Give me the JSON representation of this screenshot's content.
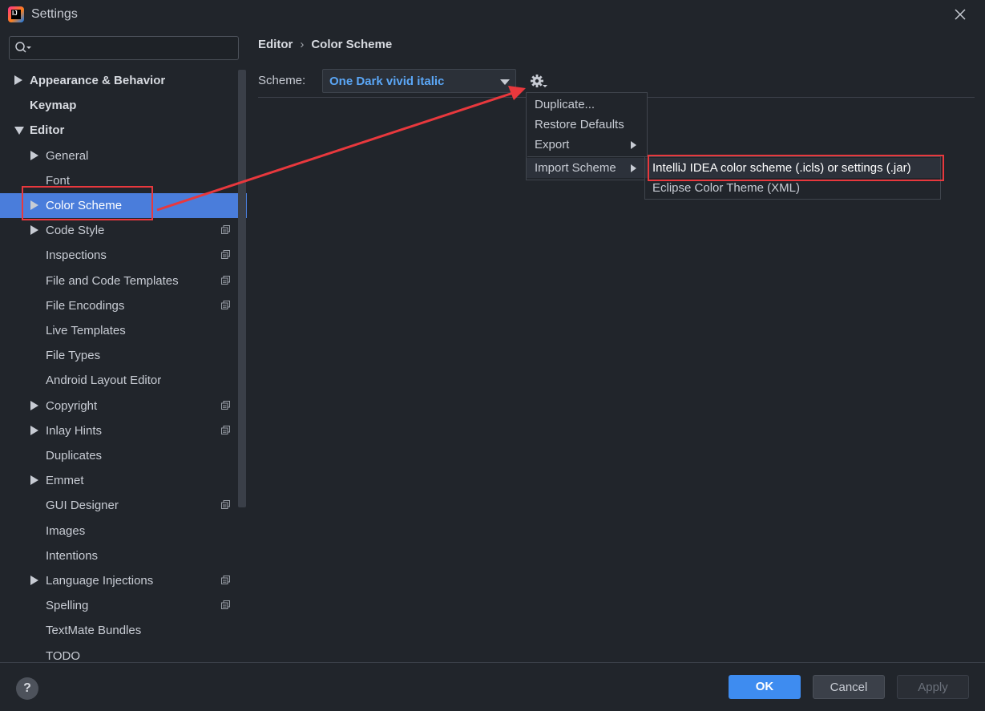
{
  "window": {
    "title": "Settings",
    "app_icon_text": "IJ"
  },
  "search": {
    "placeholder": ""
  },
  "sidebar": {
    "items": [
      {
        "label": "Appearance & Behavior",
        "expander": "right",
        "bold": true
      },
      {
        "label": "Keymap",
        "expander": "none",
        "bold": true
      },
      {
        "label": "Editor",
        "expander": "down",
        "bold": true
      },
      {
        "label": "General",
        "expander": "right"
      },
      {
        "label": "Font",
        "expander": "none"
      },
      {
        "label": "Color Scheme",
        "expander": "right",
        "selected": true
      },
      {
        "label": "Code Style",
        "expander": "right",
        "copy_icon": true
      },
      {
        "label": "Inspections",
        "expander": "none",
        "copy_icon": true
      },
      {
        "label": "File and Code Templates",
        "expander": "none",
        "copy_icon": true
      },
      {
        "label": "File Encodings",
        "expander": "none",
        "copy_icon": true
      },
      {
        "label": "Live Templates",
        "expander": "none"
      },
      {
        "label": "File Types",
        "expander": "none"
      },
      {
        "label": "Android Layout Editor",
        "expander": "none"
      },
      {
        "label": "Copyright",
        "expander": "right",
        "copy_icon": true
      },
      {
        "label": "Inlay Hints",
        "expander": "right",
        "copy_icon": true
      },
      {
        "label": "Duplicates",
        "expander": "none"
      },
      {
        "label": "Emmet",
        "expander": "right"
      },
      {
        "label": "GUI Designer",
        "expander": "none",
        "copy_icon": true
      },
      {
        "label": "Images",
        "expander": "none"
      },
      {
        "label": "Intentions",
        "expander": "none"
      },
      {
        "label": "Language Injections",
        "expander": "right",
        "copy_icon": true
      },
      {
        "label": "Spelling",
        "expander": "none",
        "copy_icon": true
      },
      {
        "label": "TextMate Bundles",
        "expander": "none"
      },
      {
        "label": "TODO",
        "expander": "none"
      }
    ]
  },
  "breadcrumb": {
    "parent": "Editor",
    "separator": "›",
    "current": "Color Scheme"
  },
  "scheme": {
    "label": "Scheme:",
    "value": "One Dark vivid italic"
  },
  "gear_menu": {
    "items": [
      {
        "label": "Duplicate..."
      },
      {
        "label": "Restore Defaults"
      },
      {
        "label": "Export",
        "submenu": true
      },
      {
        "label": "Import Scheme",
        "submenu": true,
        "active": true
      }
    ]
  },
  "import_submenu": {
    "items": [
      {
        "label": "IntelliJ IDEA color scheme (.icls) or settings (.jar)",
        "highlighted": true
      },
      {
        "label": "Eclipse Color Theme (XML)"
      }
    ]
  },
  "footer": {
    "help": "?",
    "ok": "OK",
    "cancel": "Cancel",
    "apply": "Apply"
  },
  "colors": {
    "background": "#21252b",
    "selection": "#4a7ddb",
    "accent": "#3e8cf0",
    "scheme_value": "#5ba7f7",
    "annotation": "#e8383d"
  }
}
